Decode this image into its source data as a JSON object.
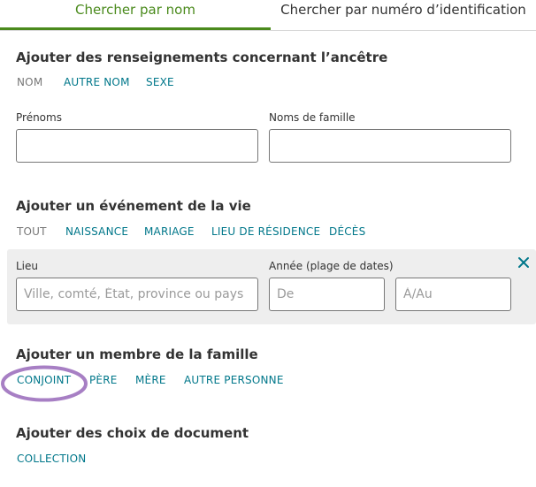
{
  "tabs": [
    {
      "label": "Chercher par nom"
    },
    {
      "label": "Chercher par numéro d’identification"
    }
  ],
  "ancestor": {
    "title": "Ajouter des renseignements concernant l’ancêtre",
    "links": [
      "NOM",
      "AUTRE NOM",
      "SEXE"
    ],
    "first_names_label": "Prénoms",
    "first_names_value": "",
    "last_names_label": "Noms de famille",
    "last_names_value": ""
  },
  "life_event": {
    "title": "Ajouter un événement de la vie",
    "links": [
      "TOUT",
      "NAISSANCE",
      "MARIAGE",
      "LIEU DE RÉSIDENCE",
      "DÉCÈS"
    ],
    "place_label": "Lieu",
    "place_placeholder": "Ville, comté, État, province ou pays",
    "year_label": "Année (plage de dates)",
    "from_placeholder": "De",
    "to_placeholder": "À/Au",
    "close_icon": "close-x-icon"
  },
  "family": {
    "title": "Ajouter un membre de la famille",
    "links": [
      "CONJOINT",
      "PÈRE",
      "MÈRE",
      "AUTRE PERSONNE"
    ]
  },
  "records": {
    "title": "Ajouter des choix de document",
    "links": [
      "COLLECTION"
    ]
  },
  "colors": {
    "accent_green": "#4a8a1c",
    "link_teal": "#00778a",
    "highlight_purple": "#a77fc4",
    "panel_gray": "#eeeeee"
  }
}
